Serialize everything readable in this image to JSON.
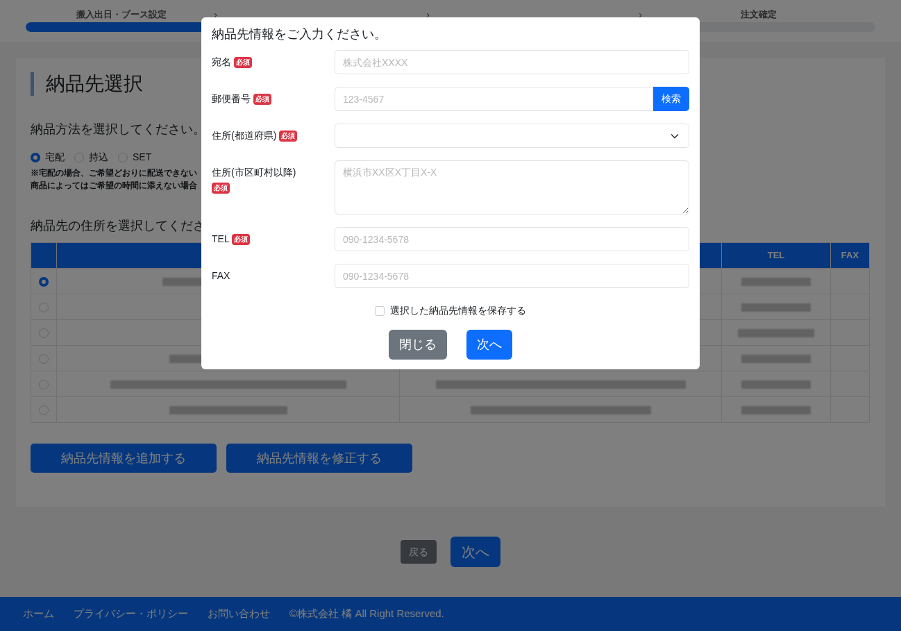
{
  "steps": {
    "items": [
      {
        "kind": "label",
        "label": "搬入出日・ブース設定"
      },
      {
        "kind": "covered"
      },
      {
        "kind": "covered"
      },
      {
        "kind": "label",
        "label": "注文確定"
      }
    ],
    "separator": "›",
    "level": 0.25
  },
  "page": {
    "title": "納品先選択",
    "method_prompt": "納品方法を選択してください。",
    "methods": [
      {
        "label": "宅配",
        "selected": true
      },
      {
        "label": "持込",
        "selected": false
      },
      {
        "label": "SET",
        "selected": false
      }
    ],
    "notes": [
      "※宅配の場合、ご希望どおりに配送できない",
      "商品によってはご希望の時間に添えない場合"
    ],
    "address_prompt": "納品先の住所を選択してくださ",
    "table": {
      "columns": [
        {
          "label": "TEL"
        },
        {
          "label": "FAX"
        }
      ],
      "rows": [
        {
          "selected": true
        },
        {
          "selected": false
        },
        {
          "selected": false
        },
        {
          "selected": false
        },
        {
          "selected": false
        },
        {
          "selected": false
        }
      ]
    },
    "buttons": [
      "納品先情報を追加する",
      "納品先情報を修正する"
    ],
    "nav": {
      "back": "戻る",
      "next": "次へ"
    }
  },
  "footer": {
    "links": [
      "ホーム",
      "プライバシー・ポリシー",
      "お問い合わせ"
    ],
    "copyright": "©株式会社 橘 All Right Reserved."
  },
  "modal": {
    "title": "納品先情報をご入力ください。",
    "fields": [
      {
        "kind": "input",
        "label": "宛名",
        "badge": "必須",
        "placeholder": "株式会社XXXX"
      },
      {
        "kind": "input_button",
        "label": "郵便番号",
        "badge": "必須",
        "placeholder": "123-4567",
        "button": "検索"
      },
      {
        "kind": "select",
        "label": "住所(都道府県)",
        "badge": "必須"
      },
      {
        "kind": "textarea",
        "label": "住所(市区町村以降)",
        "badge": "必須",
        "placeholder": "横浜市XX区X丁目X-X"
      },
      {
        "kind": "input",
        "label": "TEL",
        "badge": "必須",
        "placeholder": "090-1234-5678"
      },
      {
        "kind": "input",
        "label": "FAX",
        "placeholder": "090-1234-5678"
      }
    ],
    "save": {
      "label": "選択した納品先情報を保存する",
      "checked": false
    },
    "buttons": {
      "close": "閉じる",
      "next": "次へ"
    }
  }
}
